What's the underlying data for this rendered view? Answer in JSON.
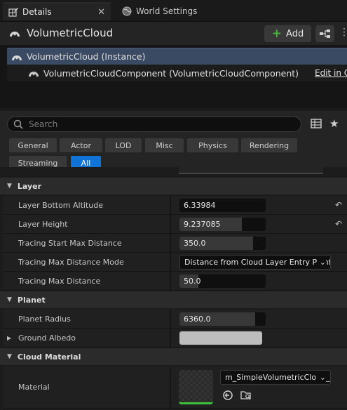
{
  "tabs": [
    {
      "label": "Details",
      "icon": "pencil-grid-icon",
      "active": true
    },
    {
      "label": "World Settings",
      "icon": "globe-icon",
      "active": false
    }
  ],
  "actor": {
    "name": "VolumetricCloud",
    "add_label": "Add"
  },
  "components": {
    "root": "VolumetricCloud (Instance)",
    "child": "VolumetricCloudComponent (VolumetricCloudComponent)",
    "edit_link": "Edit in C++"
  },
  "search": {
    "placeholder": "Search"
  },
  "filters": [
    "General",
    "Actor",
    "LOD",
    "Misc",
    "Physics",
    "Rendering",
    "Streaming",
    "All"
  ],
  "active_filter": "All",
  "categories": {
    "layer": "Layer",
    "planet": "Planet",
    "cloud_material": "Cloud Material"
  },
  "layer": {
    "bottom_altitude": {
      "label": "Layer Bottom Altitude",
      "value": "6.33984"
    },
    "height": {
      "label": "Layer Height",
      "value": "9.237085"
    },
    "tracing_start_max": {
      "label": "Tracing Start Max Distance",
      "value": "350.0"
    },
    "tracing_mode": {
      "label": "Tracing Max Distance Mode",
      "value": "Distance from Cloud Layer Entry Point"
    },
    "tracing_max": {
      "label": "Tracing Max Distance",
      "value": "50.0"
    }
  },
  "planet": {
    "radius": {
      "label": "Planet Radius",
      "value": "6360.0"
    },
    "albedo": {
      "label": "Ground Albedo",
      "color": "#bdbdbd"
    }
  },
  "material": {
    "label": "Material",
    "value": "m_SimpleVolumetricCloud_Inst"
  },
  "colors": {
    "accent": "#0f73d8",
    "selection": "#3a4a62",
    "add_plus": "#46b33b"
  }
}
